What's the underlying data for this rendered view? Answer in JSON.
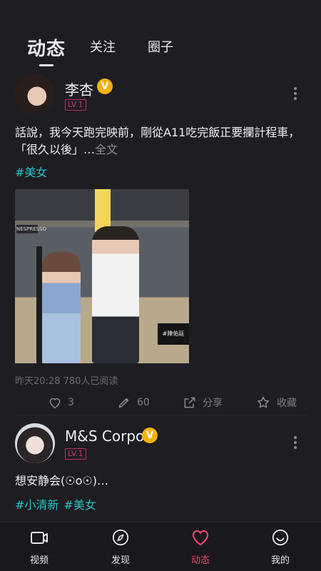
{
  "top_tabs": {
    "active": "动态",
    "tab2": "关注",
    "tab3": "圈子"
  },
  "posts": [
    {
      "username": "李杏",
      "verified_badge": "V",
      "level": "LV.1",
      "text": "話說，我今天跑完映前，剛從A11吃完飯正要攔計程車，「很久以後」…",
      "more_label": "全文",
      "tags": [
        "#美女"
      ],
      "photo_text": {
        "sign": "NESPRESSO",
        "box_label": "#陳佑廷"
      },
      "meta": "昨天20:28  780人已阅读",
      "actions": {
        "like_count": "3",
        "comment_count": "60",
        "share_label": "分享",
        "fav_label": "收藏"
      }
    },
    {
      "username": "M&S Corpor",
      "verified_badge": "V",
      "level": "LV.1",
      "text": "想安静会(☉o☉)…",
      "tags": [
        "#小清新",
        "#美女"
      ]
    }
  ],
  "bottom_nav": {
    "items": [
      {
        "label": "视频",
        "icon": "video-icon"
      },
      {
        "label": "发现",
        "icon": "compass-icon"
      },
      {
        "label": "动态",
        "icon": "heart-icon",
        "active": true
      },
      {
        "label": "我的",
        "icon": "smiley-icon"
      }
    ]
  },
  "colors": {
    "background": "#1e1d21",
    "accent": "#e9456f",
    "tag": "#25c0c8",
    "verified": "#f2b20b",
    "level_badge": "#b4326e"
  }
}
